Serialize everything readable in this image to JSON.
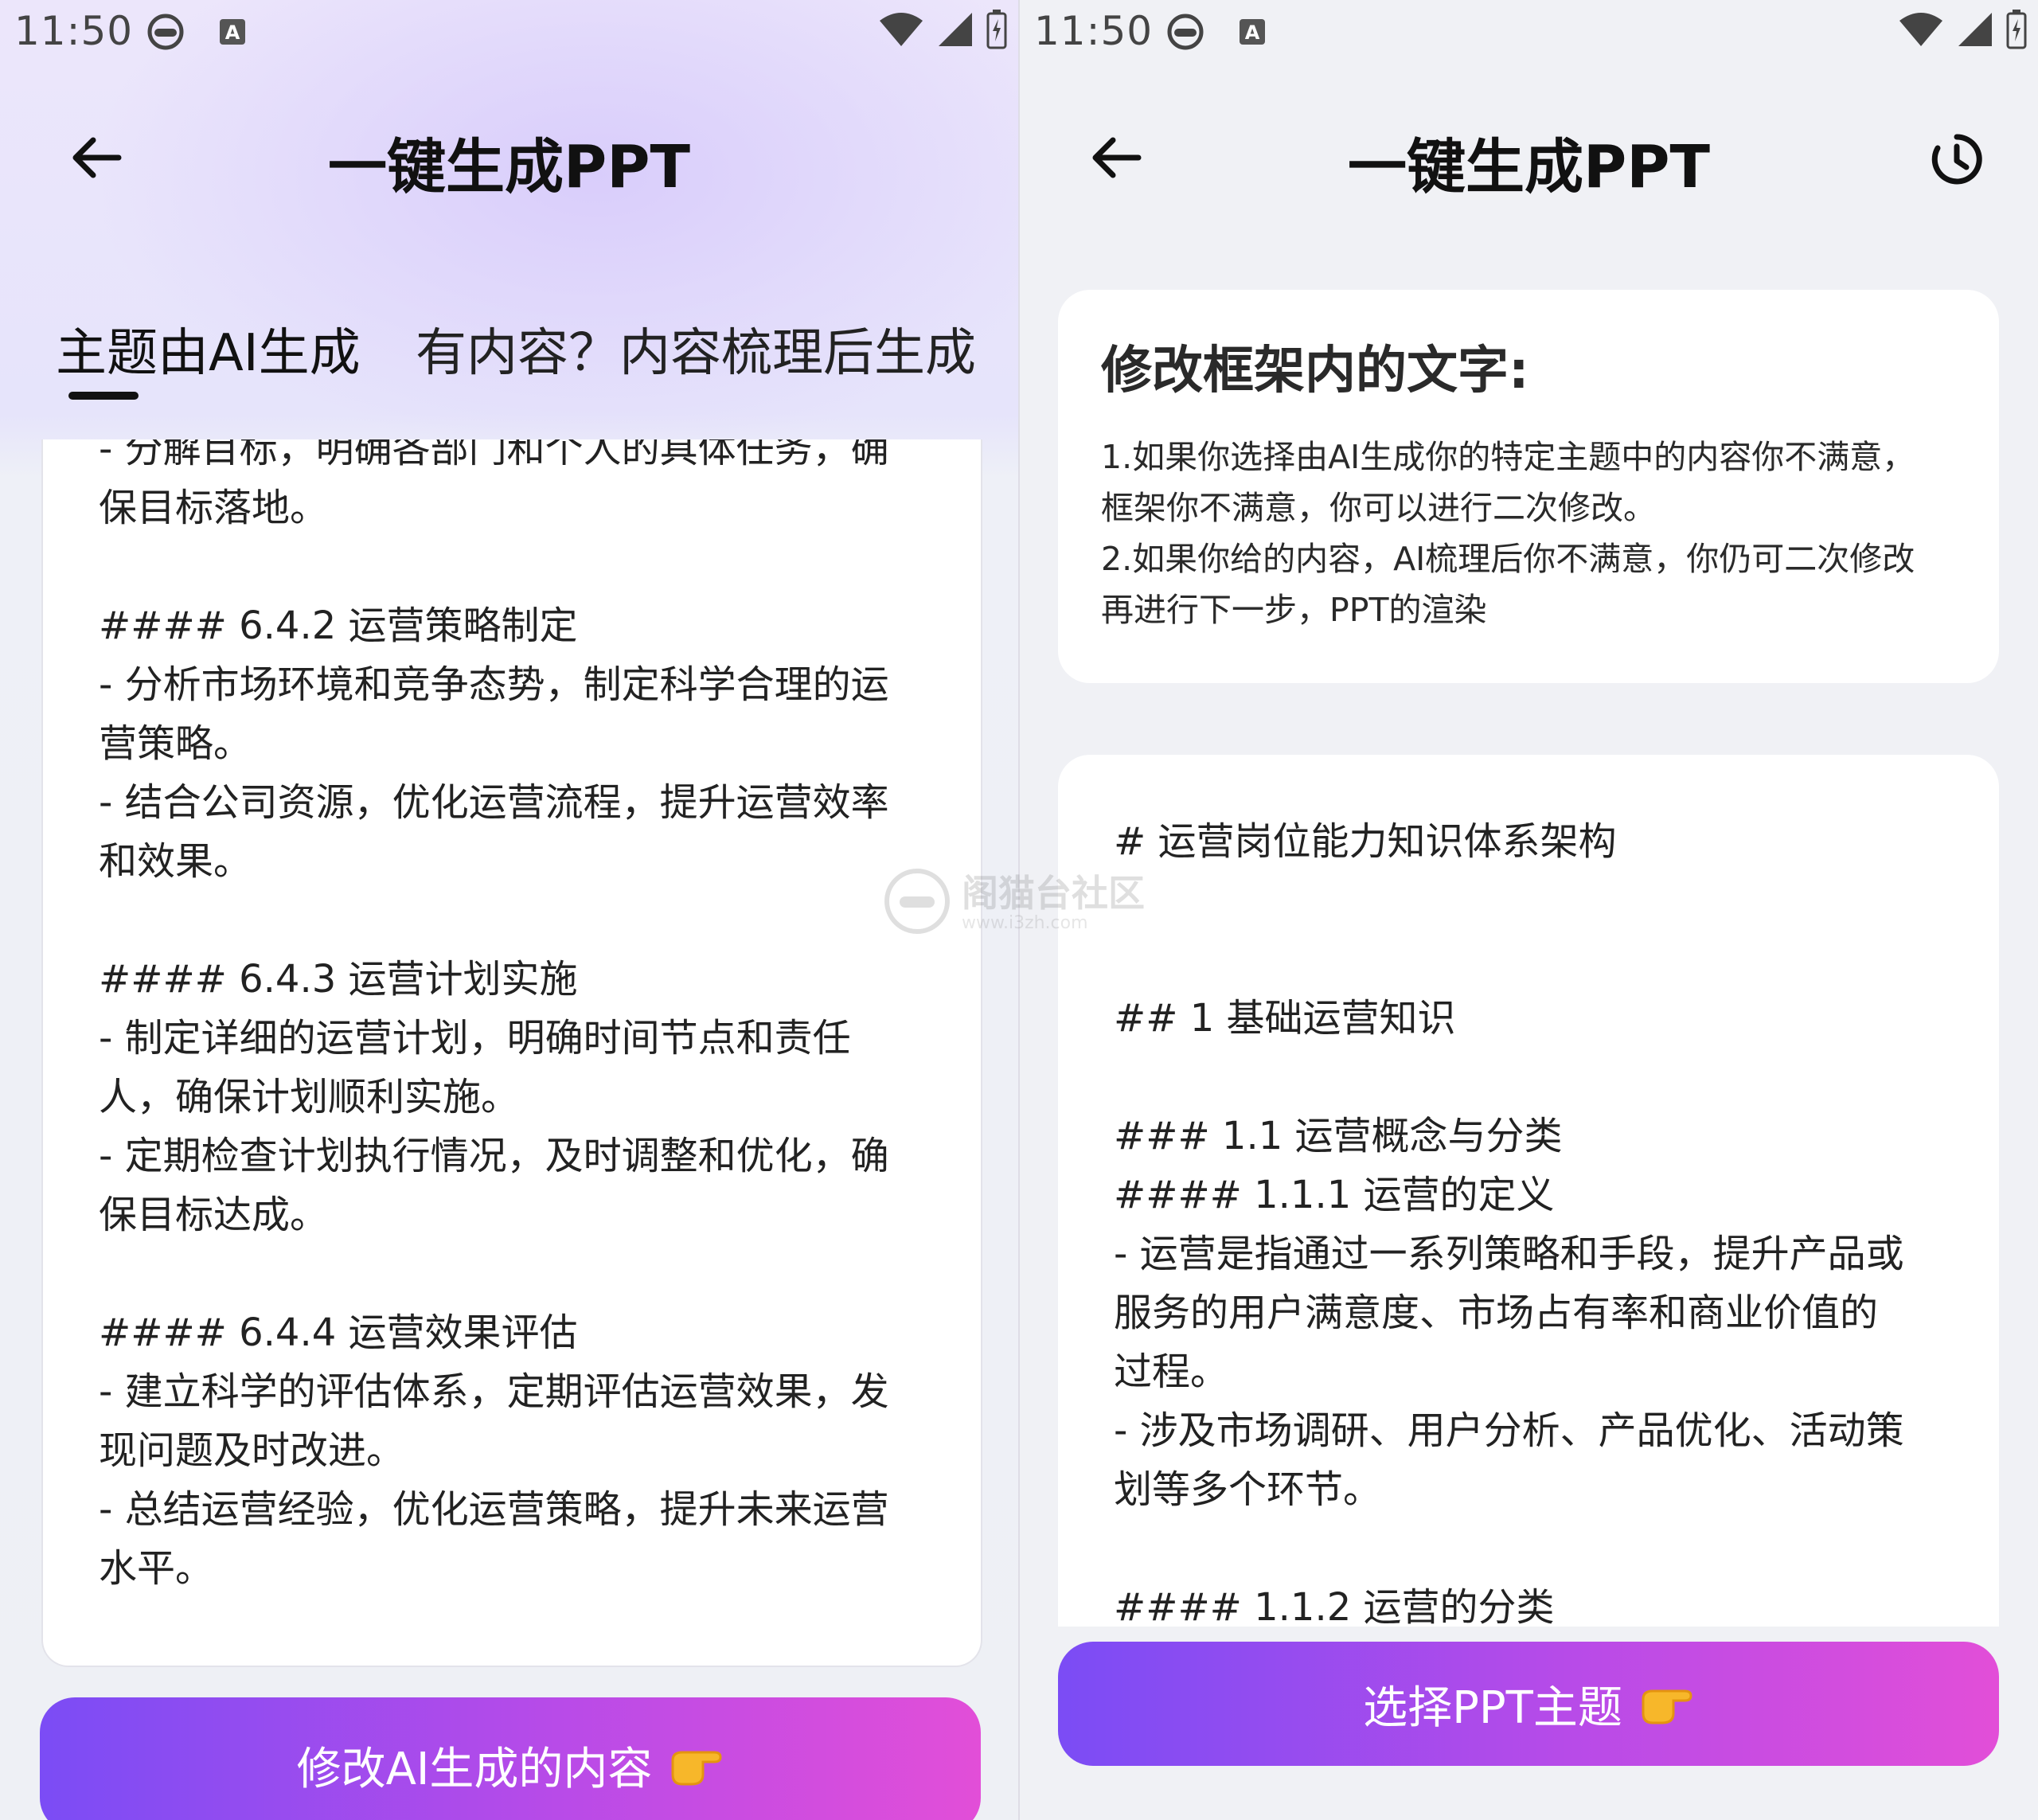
{
  "left": {
    "status": {
      "time": "11:50"
    },
    "title": "一键生成PPT",
    "tabs": [
      {
        "label": "主题由AI生成"
      },
      {
        "label": "有内容？内容梳理后生成"
      }
    ],
    "content": "- 分解目标，明确各部门和个人的具体任务，确\n保目标落地。\n\n#### 6.4.2 运营策略制定\n- 分析市场环境和竞争态势，制定科学合理的运\n营策略。\n- 结合公司资源，优化运营流程，提升运营效率\n和效果。\n\n#### 6.4.3 运营计划实施\n- 制定详细的运营计划，明确时间节点和责任\n人，确保计划顺利实施。\n- 定期检查计划执行情况，及时调整和优化，确\n保目标达成。\n\n#### 6.4.4 运营效果评估\n- 建立科学的评估体系，定期评估运营效果，发\n现问题及时改进。\n- 总结运营经验，优化运营策略，提升未来运营\n水平。",
    "button_label": "修改AI生成的内容"
  },
  "right": {
    "status": {
      "time": "11:50"
    },
    "title": "一键生成PPT",
    "info": {
      "title": "修改框架内的文字:",
      "lines": [
        "1.如果你选择由AI生成你的特定主题中的内容你不满意，",
        "框架你不满意，你可以进行二次修改。",
        "2.如果你给的内容，AI梳理后你不满意，你仍可二次修改",
        "再进行下一步，PPT的渲染"
      ]
    },
    "outline": "# 运营岗位能力知识体系架构\n\n\n## 1 基础运营知识\n\n### 1.1 运营概念与分类\n#### 1.1.1 运营的定义\n- 运营是指通过一系列策略和手段，提升产品或\n服务的用户满意度、市场占有率和商业价值的\n过程。\n- 涉及市场调研、用户分析、产品优化、活动策\n划等多个环节。\n\n#### 1.1.2 运营的分类",
    "button_label": "选择PPT主题"
  },
  "watermark": {
    "text": "阁猫台社区",
    "sub": "www.i3zh.com"
  },
  "icons": {
    "back": "arrow-left-icon",
    "history": "history-clock-icon",
    "wifi": "wifi-icon",
    "signal": "signal-icon",
    "battery": "battery-charging-icon",
    "pointing": "pointing-hand-emoji"
  },
  "colors": {
    "button_start": "#7b4cf5",
    "button_end": "#e24ed8"
  }
}
